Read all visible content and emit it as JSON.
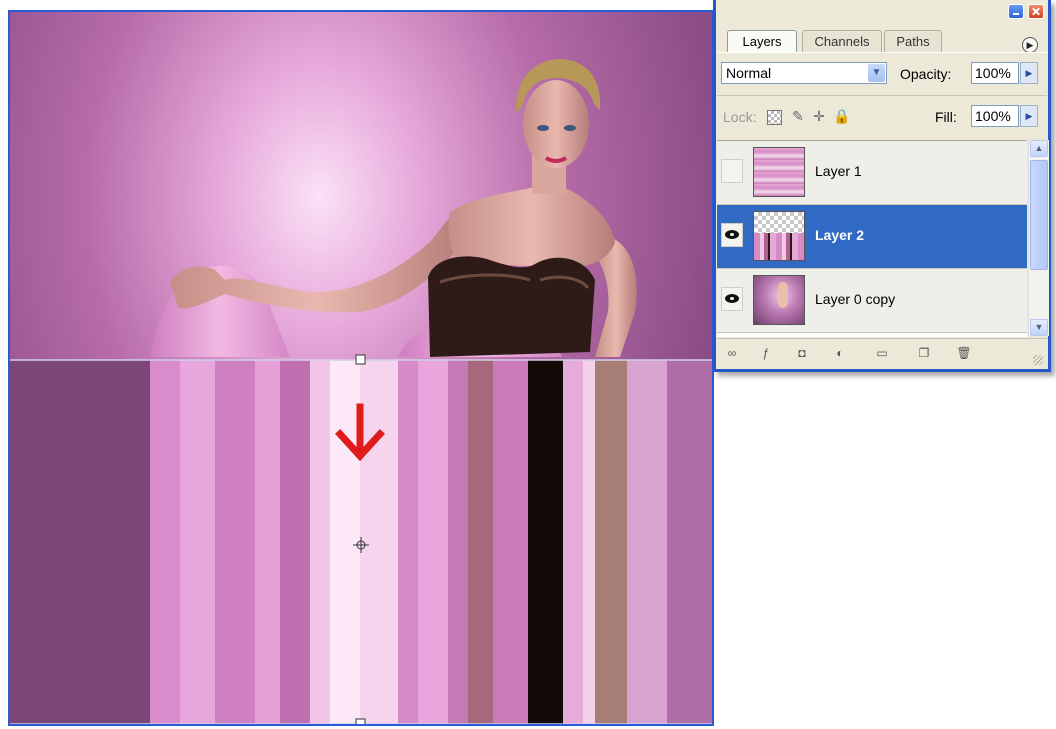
{
  "window": {
    "minimize_icon": "minimize-icon",
    "close_icon": "close-icon"
  },
  "tabs": [
    "Layers",
    "Channels",
    "Paths"
  ],
  "options": {
    "blend_mode": "Normal",
    "opacity_label": "Opacity:",
    "opacity_value": "100%",
    "lock_label": "Lock:",
    "fill_label": "Fill:",
    "fill_value": "100%"
  },
  "layers": [
    {
      "name": "Layer 1",
      "visible": false,
      "selected": false
    },
    {
      "name": "Layer 2",
      "visible": true,
      "selected": true
    },
    {
      "name": "Layer 0 copy",
      "visible": true,
      "selected": false
    }
  ],
  "bottom_icons": [
    "link-layers-icon",
    "layer-style-icon",
    "layer-mask-icon",
    "adjustment-layer-icon",
    "new-group-icon",
    "new-layer-icon",
    "delete-layer-icon"
  ],
  "canvas": {
    "arrow_color": "#e01b1b",
    "selection_color": "#2a5bd7"
  }
}
